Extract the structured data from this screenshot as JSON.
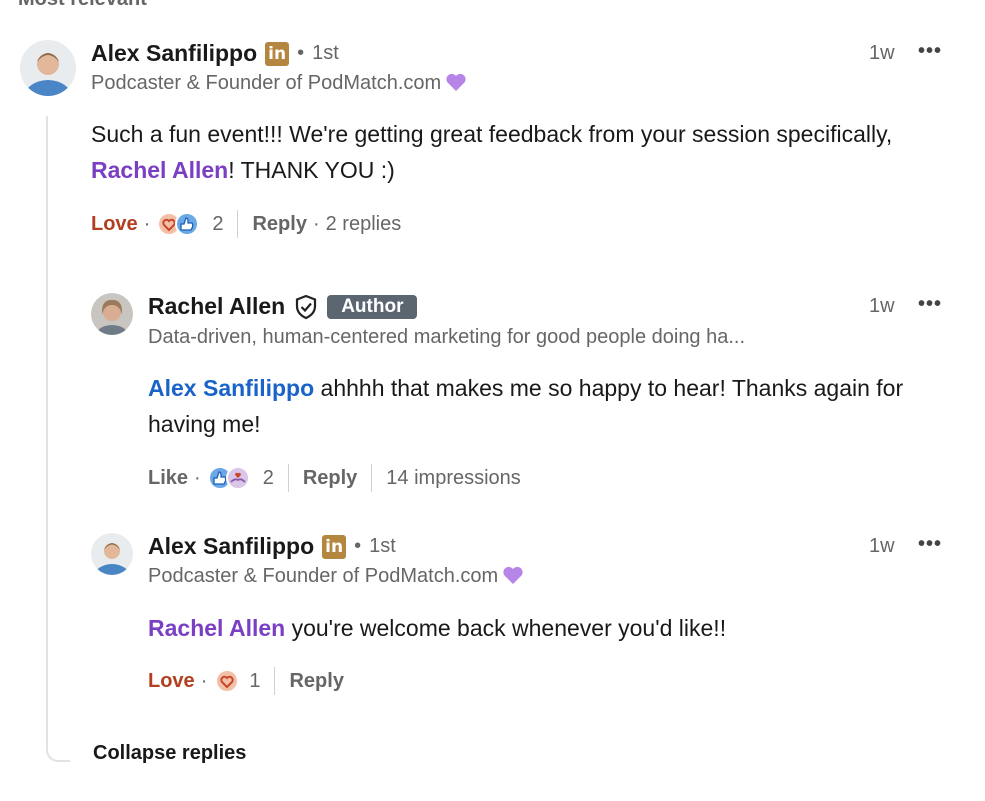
{
  "sort_label": "Most relevant",
  "comment": {
    "author": "Alex Sanfilippo",
    "degree": "1st",
    "headline": "Podcaster & Founder of PodMatch.com",
    "time": "1w",
    "text_before": "Such a fun event!!! We're getting great feedback from your session specifically, ",
    "mention": "Rachel Allen",
    "text_after": "! THANK YOU :)",
    "reaction_label": "Love",
    "reaction_count": "2",
    "reply_label": "Reply",
    "replies_count": "2 replies"
  },
  "replies": [
    {
      "author": "Rachel Allen",
      "badge": "Author",
      "headline": "Data-driven, human-centered marketing for good people doing ha...",
      "time": "1w",
      "mention": "Alex Sanfilippo",
      "text_after": " ahhhh that makes me so happy to hear! Thanks again for having me!",
      "reaction_label": "Like",
      "reaction_count": "2",
      "reply_label": "Reply",
      "impressions": "14 impressions"
    },
    {
      "author": "Alex Sanfilippo",
      "degree": "1st",
      "headline": "Podcaster & Founder of PodMatch.com",
      "time": "1w",
      "mention": "Rachel Allen",
      "text_after": " you're welcome back whenever you'd like!!",
      "reaction_label": "Love",
      "reaction_count": "1",
      "reply_label": "Reply"
    }
  ],
  "collapse_label": "Collapse replies",
  "icons": {
    "linkedin_badge": "in",
    "more": "•••",
    "dot": "·",
    "bullet": "•"
  },
  "colors": {
    "love": "#b24020",
    "mention_purple": "#7b3fc4",
    "mention_blue": "#1a63c9",
    "linkedin_gold": "#b5863f",
    "author_badge": "#5c6670"
  }
}
